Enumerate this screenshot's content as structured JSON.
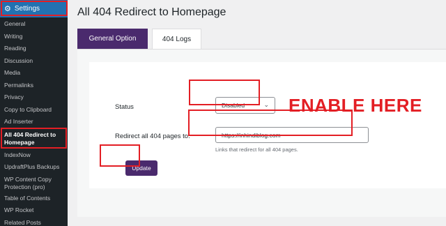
{
  "sidebar": {
    "settings_label": "Settings",
    "items": [
      {
        "label": "General"
      },
      {
        "label": "Writing"
      },
      {
        "label": "Reading"
      },
      {
        "label": "Discussion"
      },
      {
        "label": "Media"
      },
      {
        "label": "Permalinks"
      },
      {
        "label": "Privacy"
      },
      {
        "label": "Copy to Clipboard"
      },
      {
        "label": "Ad Inserter"
      },
      {
        "label": "All 404 Redirect to Homepage"
      },
      {
        "label": "IndexNow"
      },
      {
        "label": "UpdraftPlus Backups"
      },
      {
        "label": "WP Content Copy Protection (pro)"
      },
      {
        "label": "Table of Contents"
      },
      {
        "label": "WP Rocket"
      },
      {
        "label": "Related Posts"
      }
    ]
  },
  "page": {
    "title": "All 404 Redirect to Homepage"
  },
  "tabs": [
    {
      "label": "General Option",
      "active": true
    },
    {
      "label": "404 Logs",
      "active": false
    }
  ],
  "form": {
    "status_label": "Status",
    "status_value": "Disabled",
    "redirect_label": "Redirect all 404 pages to:",
    "redirect_value": "https://inhindiblog.com",
    "help_text": "Links that redirect for all 404 pages.",
    "update_label": "Update"
  },
  "annotation": {
    "text": "ENABLE HERE"
  },
  "colors": {
    "sidebar_bg": "#1d2327",
    "settings_highlight": "#2271b1",
    "brand_purple": "#4a2a6d",
    "annotation_red": "#e31e24"
  }
}
